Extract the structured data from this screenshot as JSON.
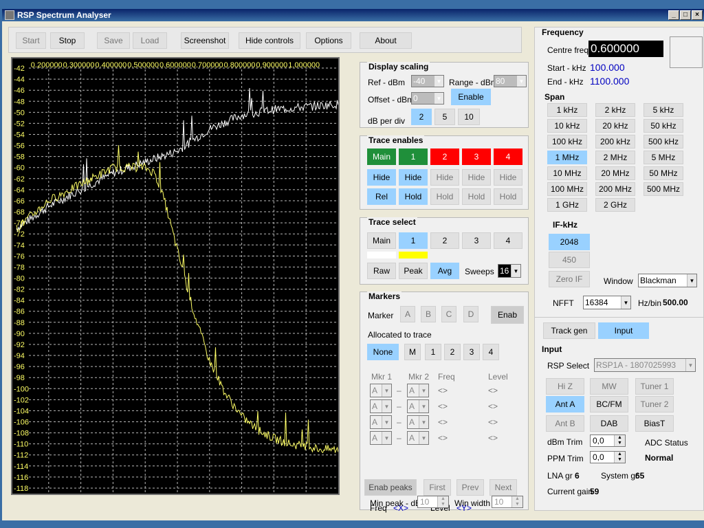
{
  "window": {
    "title": "RSP Spectrum Analyser"
  },
  "toolbar": {
    "start": "Start",
    "stop": "Stop",
    "save": "Save",
    "load": "Load",
    "screenshot": "Screenshot",
    "hide_controls": "Hide controls",
    "options": "Options",
    "about": "About"
  },
  "plot": {
    "x_labels": [
      "0.200000",
      "0.300000",
      "0.400000",
      "0.500000",
      "0.600000",
      "0.700000",
      "0.800000",
      "0.900000",
      "1.000000"
    ],
    "y_labels": [
      "-42",
      "-44",
      "-46",
      "-48",
      "-50",
      "-52",
      "-54",
      "-56",
      "-58",
      "-60",
      "-62",
      "-64",
      "-66",
      "-68",
      "-70",
      "-72",
      "-74",
      "-76",
      "-78",
      "-80",
      "-82",
      "-84",
      "-86",
      "-88",
      "-90",
      "-92",
      "-94",
      "-96",
      "-98",
      "-100",
      "-102",
      "-104",
      "-106",
      "-108",
      "-110",
      "-112",
      "-114",
      "-116",
      "-118"
    ],
    "main_trace_color": "#ffffff",
    "trace1_color": "#ffff66"
  },
  "chart_data": {
    "type": "line",
    "x_label_values": [
      0.2,
      0.3,
      0.4,
      0.5,
      0.6,
      0.7,
      0.8,
      0.9,
      1.0
    ],
    "x_unit": "MHz",
    "ylim": [
      -119,
      -41
    ],
    "grid": true,
    "series": [
      {
        "x": [
          0.1,
          0.2,
          0.3,
          0.4,
          0.5,
          0.55,
          0.6,
          0.65,
          0.7,
          0.8,
          0.9,
          1.0,
          1.1
        ],
        "values": [
          -71,
          -67,
          -64,
          -61,
          -59,
          -58,
          -57,
          -55,
          -53,
          -50.5,
          -49.5,
          -49,
          -48.5
        ]
      },
      {
        "x": [
          0.1,
          0.2,
          0.3,
          0.4,
          0.5,
          0.53,
          0.56,
          0.6,
          0.65,
          0.7,
          0.75,
          0.8,
          0.85,
          0.9,
          0.95,
          1.0,
          1.05,
          1.1
        ],
        "values": [
          -71,
          -66,
          -63,
          -60,
          -60,
          -61,
          -66,
          -75,
          -86,
          -95,
          -101,
          -105,
          -107.5,
          -109,
          -110,
          -110.5,
          -111,
          -111
        ]
      }
    ]
  },
  "display_scaling": {
    "title": "Display scaling",
    "ref_label": "Ref - dBm",
    "ref_value": "-40",
    "range_label": "Range - dBm",
    "range_value": "80",
    "offset_label": "Offset - dBm",
    "offset_value": "0",
    "enable": "Enable",
    "db_per_div_label": "dB per div",
    "db_options": [
      "2",
      "5",
      "10"
    ]
  },
  "trace_enables": {
    "title": "Trace enables",
    "traces": [
      "Main",
      "1",
      "2",
      "3",
      "4"
    ],
    "hide": [
      "Hide",
      "Hide",
      "Hide",
      "Hide",
      "Hide"
    ],
    "rel": "Rel",
    "hold": [
      "Hold",
      "Hold",
      "Hold",
      "Hold"
    ]
  },
  "trace_select": {
    "title": "Trace select",
    "traces": [
      "Main",
      "1",
      "2",
      "3",
      "4"
    ],
    "raw": "Raw",
    "peak": "Peak",
    "avg": "Avg",
    "sweeps_label": "Sweeps",
    "sweeps_value": "16"
  },
  "markers": {
    "title": "Markers",
    "marker_label": "Marker",
    "letters": [
      "A",
      "B",
      "C",
      "D"
    ],
    "enab": "Enab",
    "allocated_label": "Allocated to trace",
    "alloc": [
      "None",
      "M",
      "1",
      "2",
      "3",
      "4"
    ],
    "col_mkr1": "Mkr 1",
    "col_mkr2": "Mkr 2",
    "col_freq": "Freq",
    "col_level": "Level",
    "row_a": "A",
    "row_dash": "–",
    "row_freq": "<>",
    "row_level": "<>",
    "enab_peaks": "Enab peaks",
    "first": "First",
    "prev": "Prev",
    "next": "Next",
    "freq_label": "Freq",
    "freq_value": "<X>",
    "level_label": "Level",
    "level_value": "<Y>",
    "min_peak_label": "Min peak - dB",
    "min_peak_value": "10",
    "win_width_label": "Win width",
    "win_width_value": "10"
  },
  "frequency": {
    "title": "Frequency",
    "centre_label": "Centre freq",
    "centre_value": "0.600000",
    "start_label": "Start - kHz",
    "start_value": "100.000",
    "end_label": "End - kHz",
    "end_value": "1100.000",
    "span_label": "Span",
    "spans": [
      "1 kHz",
      "2 kHz",
      "5 kHz",
      "10 kHz",
      "20 kHz",
      "50 kHz",
      "100 kHz",
      "200 kHz",
      "500 kHz",
      "1 MHz",
      "2 MHz",
      "5 MHz",
      "10 MHz",
      "20 MHz",
      "50 MHz",
      "100 MHz",
      "200 MHz",
      "500 MHz",
      "1 GHz",
      "2 GHz"
    ],
    "if_label": "IF-kHz",
    "if_options": [
      "2048",
      "450",
      "Zero IF"
    ],
    "window_label": "Window",
    "window_value": "Blackman",
    "nfft_label": "NFFT",
    "nfft_value": "16384",
    "hzbin_label": "Hz/bin",
    "hzbin_value": "500.00"
  },
  "tabs": {
    "track_gen": "Track gen",
    "input": "Input"
  },
  "input": {
    "title": "Input",
    "rsp_select_label": "RSP Select",
    "rsp_select_value": "RSP1A - 1807025993",
    "hiz": "Hi Z",
    "mw": "MW",
    "tuner1": "Tuner 1",
    "anta": "Ant A",
    "bcfm": "BC/FM",
    "tuner2": "Tuner 2",
    "antb": "Ant B",
    "dab": "DAB",
    "biast": "BiasT",
    "dbm_trim_label": "dBm Trim",
    "dbm_trim_value": "0,0",
    "ppm_trim_label": "PPM Trim",
    "ppm_trim_value": "0,0",
    "adc_status_label": "ADC Status",
    "adc_status_value": "Normal",
    "lna_label": "LNA gr",
    "lna_value": "6",
    "system_label": "System gr",
    "system_value": "65",
    "current_label": "Current gain",
    "current_value": "59"
  }
}
